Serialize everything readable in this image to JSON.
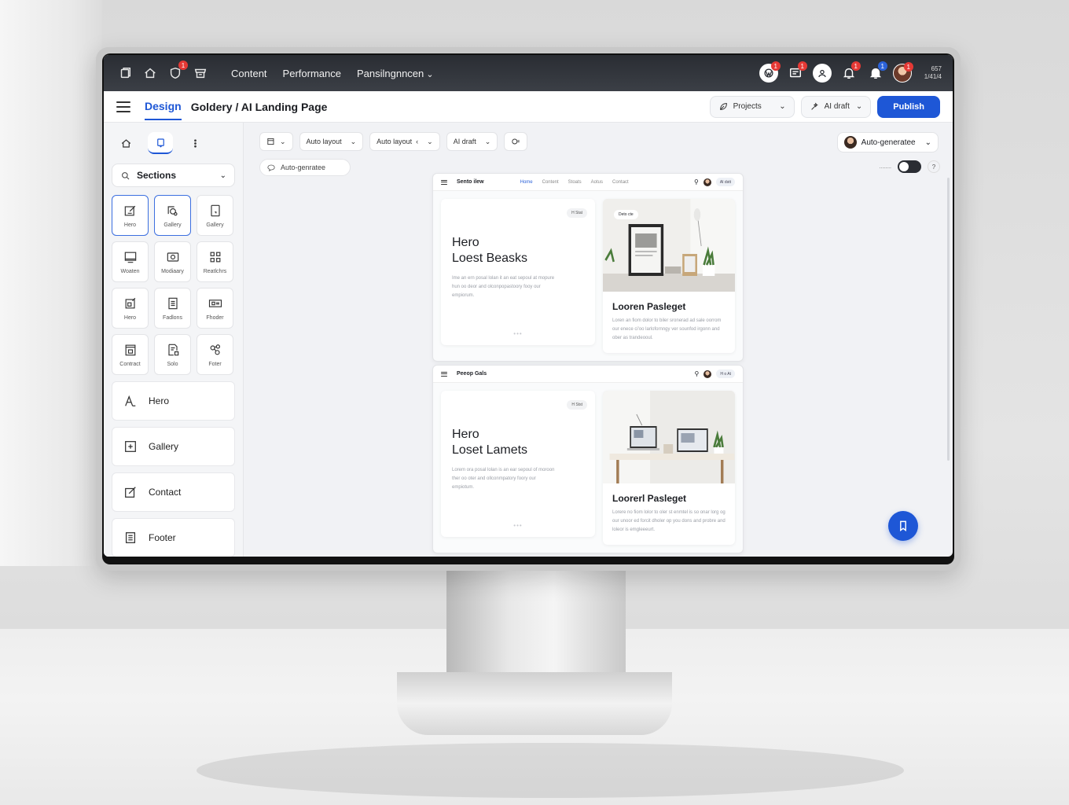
{
  "topbar": {
    "nav": [
      "Content",
      "Performance",
      "Pansilngnncen"
    ],
    "home_badge": "1",
    "right_badges": [
      "1",
      "1",
      "1",
      "1",
      "1"
    ],
    "time": "657",
    "date": "1/41/4"
  },
  "header": {
    "tab": "Design",
    "title": "Goldery / AI Landing Page",
    "projects_label": "Projects",
    "ai_draft_label": "AI draft",
    "publish_label": "Publish"
  },
  "sidebar": {
    "sections_label": "Sections",
    "tiles": [
      {
        "label": "Hero",
        "icon": "edit-icon"
      },
      {
        "label": "Gallery",
        "icon": "gallery-search-icon"
      },
      {
        "label": "Gallery",
        "icon": "tablet-icon"
      },
      {
        "label": "Woaten",
        "icon": "monitor-icon"
      },
      {
        "label": "Modiaary",
        "icon": "camera-icon"
      },
      {
        "label": "Reatlchrs",
        "icon": "grid-icon"
      },
      {
        "label": "Hero",
        "icon": "image-edit-icon"
      },
      {
        "label": "Fadlons",
        "icon": "document-icon"
      },
      {
        "label": "Fhoder",
        "icon": "film-icon"
      },
      {
        "label": "Contract",
        "icon": "contract-icon"
      },
      {
        "label": "Solo",
        "icon": "form-icon"
      },
      {
        "label": "Foter",
        "icon": "link-icon"
      }
    ],
    "list": [
      {
        "label": "Hero",
        "icon": "text-icon"
      },
      {
        "label": "Gallery",
        "icon": "gallery-icon"
      },
      {
        "label": "Contact",
        "icon": "contact-edit-icon"
      },
      {
        "label": "Footer",
        "icon": "footer-icon"
      }
    ]
  },
  "canvas": {
    "toolbar": [
      "Auto layout",
      "Auto layout",
      "AI draft"
    ],
    "auto_chip": "Auto-genratee",
    "auto_generate": "Auto-generatee",
    "toggle_label": "........",
    "help": "?"
  },
  "preview1": {
    "brand": "Sento ilew",
    "links": [
      "Home",
      "Content",
      "Stoats",
      "Aotus",
      "Contact"
    ],
    "pill": "AI dstt",
    "tag": "H Stat",
    "heading_line1": "Hero",
    "heading_line2": "Loest Beasks",
    "body": "Ime an ern posal lolan it an eat sepoul at mopure hun oo deor and olconpopastoory fooy our empiorum.",
    "dots": "•••",
    "img_tag": "Deto cte",
    "card_title": "Looren Pasleget",
    "card_body": "Loren an fiom dolor to biler sronerad ad sale oorrom our enece ci'oo larlofornngy ver sounfod irgonn and ober as trandeooul."
  },
  "preview2": {
    "brand": "Peeop Gals",
    "pill": "H o At",
    "tag": "H Stst",
    "heading_line1": "Hero",
    "heading_line2": "Loset Lamets",
    "body": "Lorem ora posal lolan is an ear sepoul of moroon ther oo oter and ollconmpatory foory our empiotum.",
    "dots": "•••",
    "card_title": "Loorerl Pasleget",
    "card_body": "Lorere no fiom lolor to oler st enmtel is so onar lorg og our unoor ed forcit dholer op you dons and probre and loleor is emgleeeurt."
  },
  "colors": {
    "accent": "#1e57d6",
    "topbar": "#2a2d33",
    "badge": "#e53935"
  }
}
